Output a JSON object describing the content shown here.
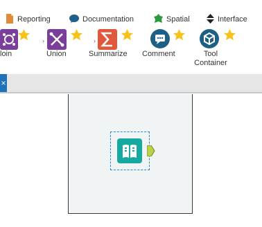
{
  "tabs": [
    {
      "label": "Reporting",
      "icon": "reporting-icon",
      "color": "#e28a3a"
    },
    {
      "label": "Documentation",
      "icon": "documentation-icon",
      "color": "#1f5f8b"
    },
    {
      "label": "Spatial",
      "icon": "spatial-icon",
      "color": "#2a9a3c"
    },
    {
      "label": "Interface",
      "icon": "interface-icon",
      "color": "#222222"
    }
  ],
  "tools": [
    {
      "label": "Join",
      "visible_label": "loin",
      "icon": "join-icon",
      "color": "#7a3f9a"
    },
    {
      "label": "Union",
      "icon": "union-icon",
      "color": "#7a3f9a"
    },
    {
      "label": "Summarize",
      "icon": "summarize-icon",
      "color": "#e0573b"
    },
    {
      "label": "Comment",
      "icon": "comment-icon",
      "color": "#1e5f86"
    },
    {
      "label": "Tool",
      "label2": "Container",
      "icon": "tool-container-icon",
      "color": "#1e5f86"
    }
  ],
  "canvas": {
    "close_glyph": "×",
    "selected_tool_icon": "book-icon",
    "tool_color": "#15a9a0",
    "anchor_color": "#b9d24a"
  }
}
